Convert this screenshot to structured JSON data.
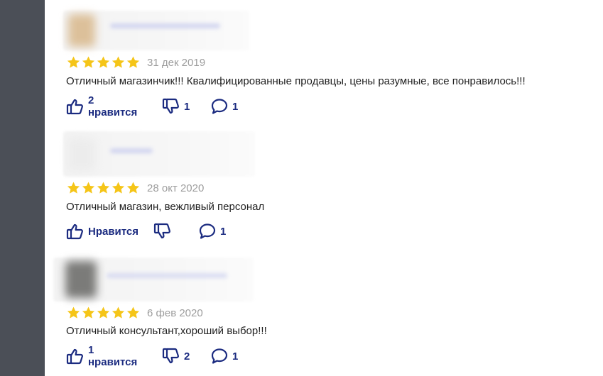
{
  "colors": {
    "sidebar": "#4b4f57",
    "star": "#f5c518",
    "action": "#1b2b80",
    "date": "#9d9d9d",
    "text": "#222222"
  },
  "icons": {
    "rating": "star-icon",
    "like": "thumbs-up-icon",
    "dislike": "thumbs-down-icon",
    "comment": "comment-bubble-icon"
  },
  "reviews": [
    {
      "rating": 5,
      "date": "31 дек 2019",
      "text": "Отличный магазинчик!!! Квалифицированные продавцы, цены разумные, все понравилось!!!",
      "likes_label": "2 нравится",
      "dislikes_label": "1",
      "comments_label": "1"
    },
    {
      "rating": 5,
      "date": "28 окт 2020",
      "text": "Отличный магазин, вежливый персонал",
      "likes_label": "Нравится",
      "dislikes_label": "",
      "comments_label": "1"
    },
    {
      "rating": 5,
      "date": "6 фев 2020",
      "text": "Отличный консультант,хороший выбор!!!",
      "likes_label": "1 нравится",
      "dislikes_label": "2",
      "comments_label": "1"
    }
  ]
}
